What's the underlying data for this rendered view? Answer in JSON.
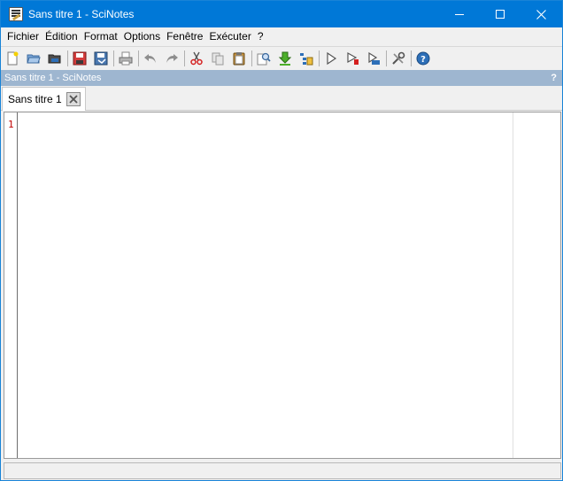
{
  "window": {
    "title": "Sans titre 1 - SciNotes",
    "icon": "scinotes-app-icon",
    "controls": [
      "minimize-icon",
      "maximize-icon",
      "close-icon"
    ]
  },
  "menubar": {
    "items": [
      {
        "label": "Fichier"
      },
      {
        "label": "Édition"
      },
      {
        "label": "Format"
      },
      {
        "label": "Options"
      },
      {
        "label": "Fenêtre"
      },
      {
        "label": "Exécuter"
      },
      {
        "label": "?"
      }
    ]
  },
  "toolbar": {
    "buttons": [
      "new-file-icon",
      "open-file-icon",
      "open-recent-icon",
      "|",
      "save-icon",
      "save-as-icon",
      "|",
      "print-icon",
      "|",
      "undo-icon",
      "redo-icon",
      "|",
      "cut-icon",
      "copy-icon",
      "paste-icon",
      "|",
      "find-replace-icon",
      "download-icon",
      "indent-icon",
      "|",
      "execute-icon",
      "execute-file-icon",
      "execute-until-icon",
      "|",
      "preferences-icon",
      "|",
      "help-icon"
    ]
  },
  "dock": {
    "title": "Sans titre 1 - SciNotes",
    "help": "?"
  },
  "tabs": [
    {
      "label": "Sans titre 1",
      "active": true
    }
  ],
  "editor": {
    "line_numbers": [
      "1"
    ],
    "content": ""
  },
  "colors": {
    "titlebar": "#0078d7",
    "dock_header": "#9eb6d0",
    "line_number": "#c00000"
  }
}
